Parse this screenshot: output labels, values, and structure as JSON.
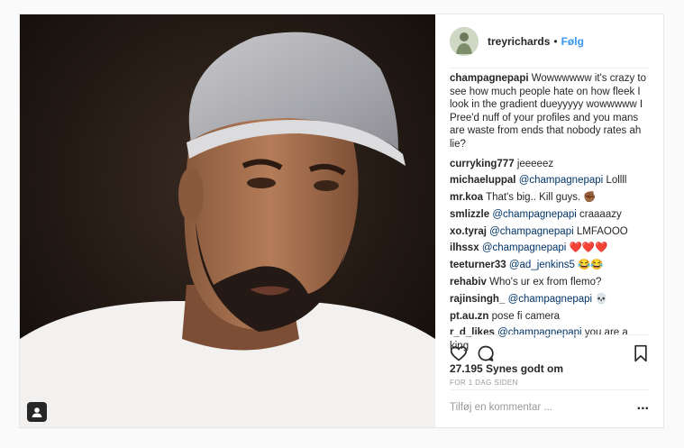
{
  "post": {
    "author": "treyrichards",
    "separator": "•",
    "follow_label": "Følg",
    "caption": {
      "user": "champagnepapi",
      "text": "Wowwwwww it's crazy to see how much people hate on how fleek I look in the gradient dueyyyyy wowwwww I Pree'd nuff of your profiles and you mans are waste from ends that nobody rates ah lie?"
    },
    "comments": [
      {
        "user": "curryking777",
        "mention": "",
        "text": "jeeeeez"
      },
      {
        "user": "michaeluppal",
        "mention": "@champagnepapi",
        "text": "Lollll"
      },
      {
        "user": "mr.koa",
        "mention": "",
        "text": "That's big.. Kill guys. ✊🏾"
      },
      {
        "user": "smlizzle",
        "mention": "@champagnepapi",
        "text": "craaaazy"
      },
      {
        "user": "xo.tyraj",
        "mention": "@champagnepapi",
        "text": "LMFAOOO"
      },
      {
        "user": "ilhssx",
        "mention": "@champagnepapi",
        "text": "❤️❤️❤️"
      },
      {
        "user": "teeturner33",
        "mention": "@ad_jenkins5",
        "text": "😂😂"
      },
      {
        "user": "rehabiv",
        "mention": "",
        "text": "Who's ur ex from flemo?"
      },
      {
        "user": "rajinsingh_",
        "mention": "@champagnepapi",
        "text": "💀"
      },
      {
        "user": "pt.au.zn",
        "mention": "",
        "text": "pose fi camera"
      },
      {
        "user": "r_d_likes",
        "mention": "@champagnepapi",
        "text": "you are a king"
      }
    ],
    "likes_label": "27.195 Synes godt om",
    "time_label": "FOR 1 DAG SIDEN",
    "add_comment_placeholder": "Tilføj en kommentar ...",
    "more_label": "..."
  },
  "icons": {
    "like": "heart-icon",
    "comment": "comment-bubble-icon",
    "save": "bookmark-icon",
    "user_tag": "user-tag-icon"
  },
  "colors": {
    "link_blue": "#3897f0",
    "mention": "#003569",
    "text": "#262626",
    "muted": "#999999"
  }
}
